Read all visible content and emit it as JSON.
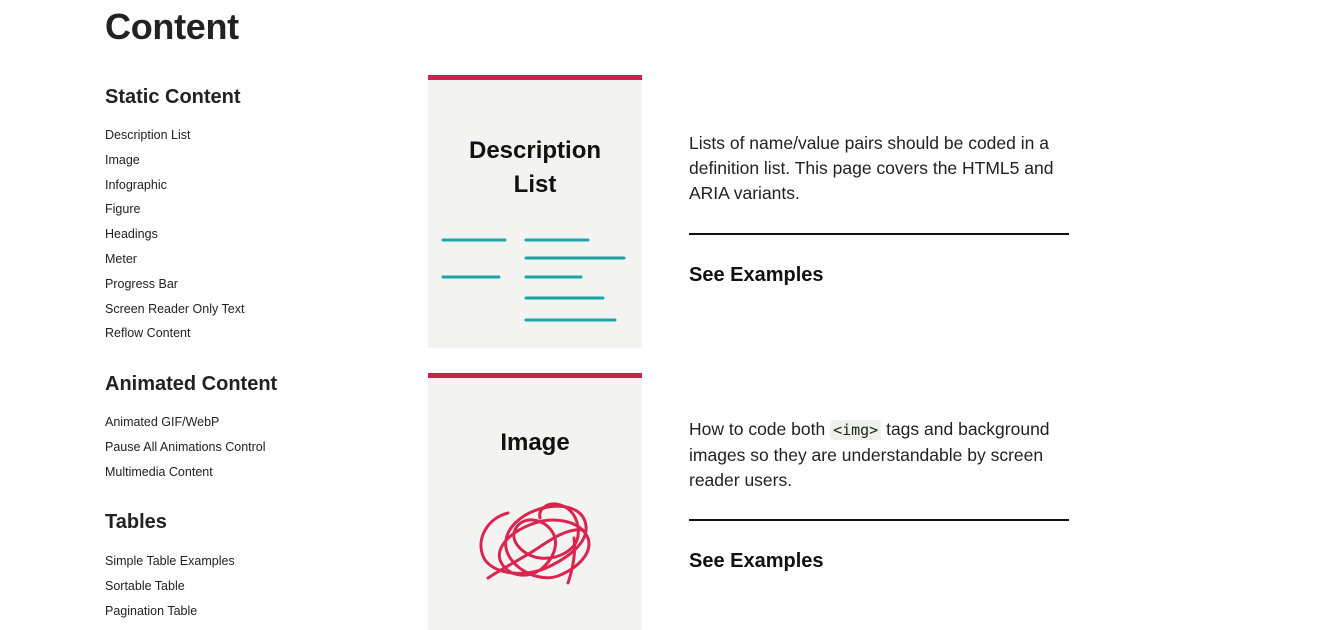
{
  "page": {
    "title": "Content"
  },
  "sidebar": {
    "sections": [
      {
        "heading": "Static Content",
        "items": [
          "Description List",
          "Image",
          "Infographic",
          "Figure",
          "Headings",
          "Meter",
          "Progress Bar",
          "Screen Reader Only Text",
          "Reflow Content"
        ]
      },
      {
        "heading": "Animated Content",
        "items": [
          "Animated GIF/WebP",
          "Pause All Animations Control",
          "Multimedia Content"
        ]
      },
      {
        "heading": "Tables",
        "items": [
          "Simple Table Examples",
          "Sortable Table",
          "Pagination Table"
        ]
      }
    ]
  },
  "cards": [
    {
      "title_line1": "Description",
      "title_line2": "List",
      "description": "Lists of name/value pairs should be coded in a definition list. This page covers the HTML5 and ARIA variants.",
      "link": "See Examples",
      "illustration": "description-list-icon"
    },
    {
      "title": "Image",
      "description_before": "How to code both ",
      "description_code": "<img>",
      "description_after": " tags and background images so they are understandable by screen reader users.",
      "link": "See Examples",
      "illustration": "scribble-image-icon"
    }
  ],
  "colors": {
    "accent": "#cf1f4a",
    "teal": "#1aa3a8",
    "card_bg": "#f3f4f2",
    "text": "#222222"
  }
}
